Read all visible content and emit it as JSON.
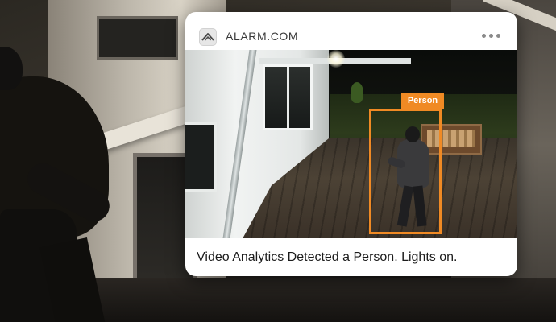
{
  "notification": {
    "app_name": "ALARM.COM",
    "app_icon": "alarm-com-logo-icon",
    "more_icon": "more-options-icon",
    "detection_label": "Person",
    "message": "Video Analytics Detected a Person. Lights on."
  },
  "colors": {
    "detection_box": "#f08a24",
    "card_background": "#ffffff",
    "text_primary": "#1c1c1c"
  }
}
